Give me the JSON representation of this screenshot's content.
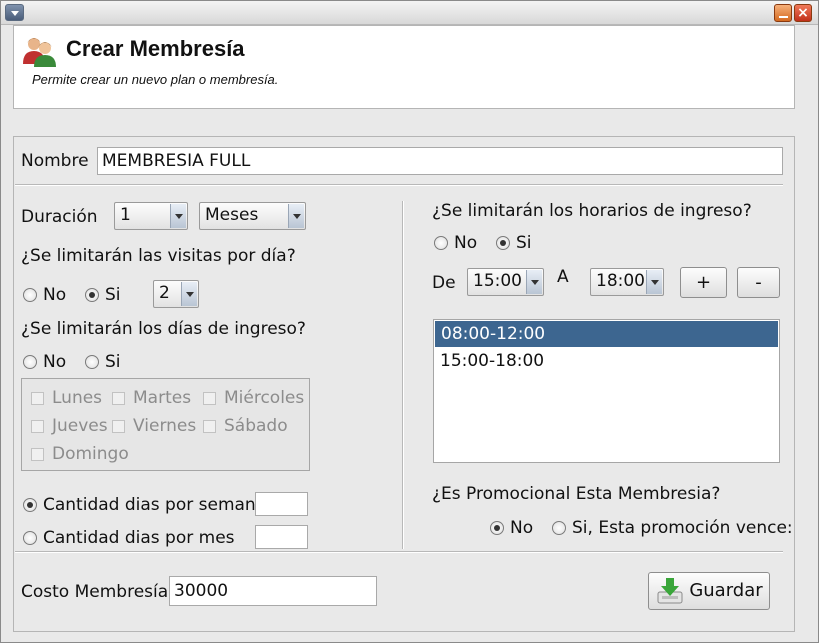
{
  "window": {
    "title": "",
    "buttons": {
      "minimize": "minimize-icon",
      "close": "×"
    }
  },
  "header": {
    "title": "Crear Membresía",
    "subtitle": "Permite crear un nuevo plan o membresía.",
    "icon": "users-icon"
  },
  "form": {
    "nombre_label": "Nombre",
    "nombre_value": "MEMBRESIA FULL",
    "duracion_label": "Duración",
    "duracion_amount": "1",
    "duracion_unit": "Meses",
    "visitas_question": "¿Se limitarán las visitas por día?",
    "visitas_options": {
      "no": "No",
      "si": "Si"
    },
    "visitas_selected": "si",
    "visitas_count": "2",
    "dias_question": "¿Se limitarán los días de ingreso?",
    "dias_options": {
      "no": "No",
      "si": "Si"
    },
    "dias_selected": "none",
    "days": [
      "Lunes",
      "Martes",
      "Miércoles",
      "Jueves",
      "Viernes",
      "Sábado",
      "Domingo"
    ],
    "cantidad_semana_label": "Cantidad dias por semana",
    "cantidad_mes_label": "Cantidad dias por mes",
    "cantidad_selected": "semana",
    "cantidad_semana_value": "",
    "cantidad_mes_value": "",
    "horarios_question": "¿Se limitarán los horarios de ingreso?",
    "horarios_options": {
      "no": "No",
      "si": "Si"
    },
    "horarios_selected": "si",
    "de_label": "De",
    "de_value": "15:00",
    "a_label": "A",
    "a_value": "18:00",
    "add_label": "+",
    "remove_label": "-",
    "horarios_list": [
      "08:00-12:00",
      "15:00-18:00"
    ],
    "horarios_selected_index": 0,
    "promo_question": "¿Es Promocional Esta Membresia?",
    "promo_options": {
      "no": "No",
      "si": "Si, Esta promoción vence:"
    },
    "promo_selected": "no",
    "costo_label": "Costo Membresía",
    "costo_value": "30000",
    "save_label": "Guardar"
  },
  "colors": {
    "selection": "#3d6690",
    "panel": "#e9e9e9",
    "save_arrow": "#3aa63a"
  }
}
